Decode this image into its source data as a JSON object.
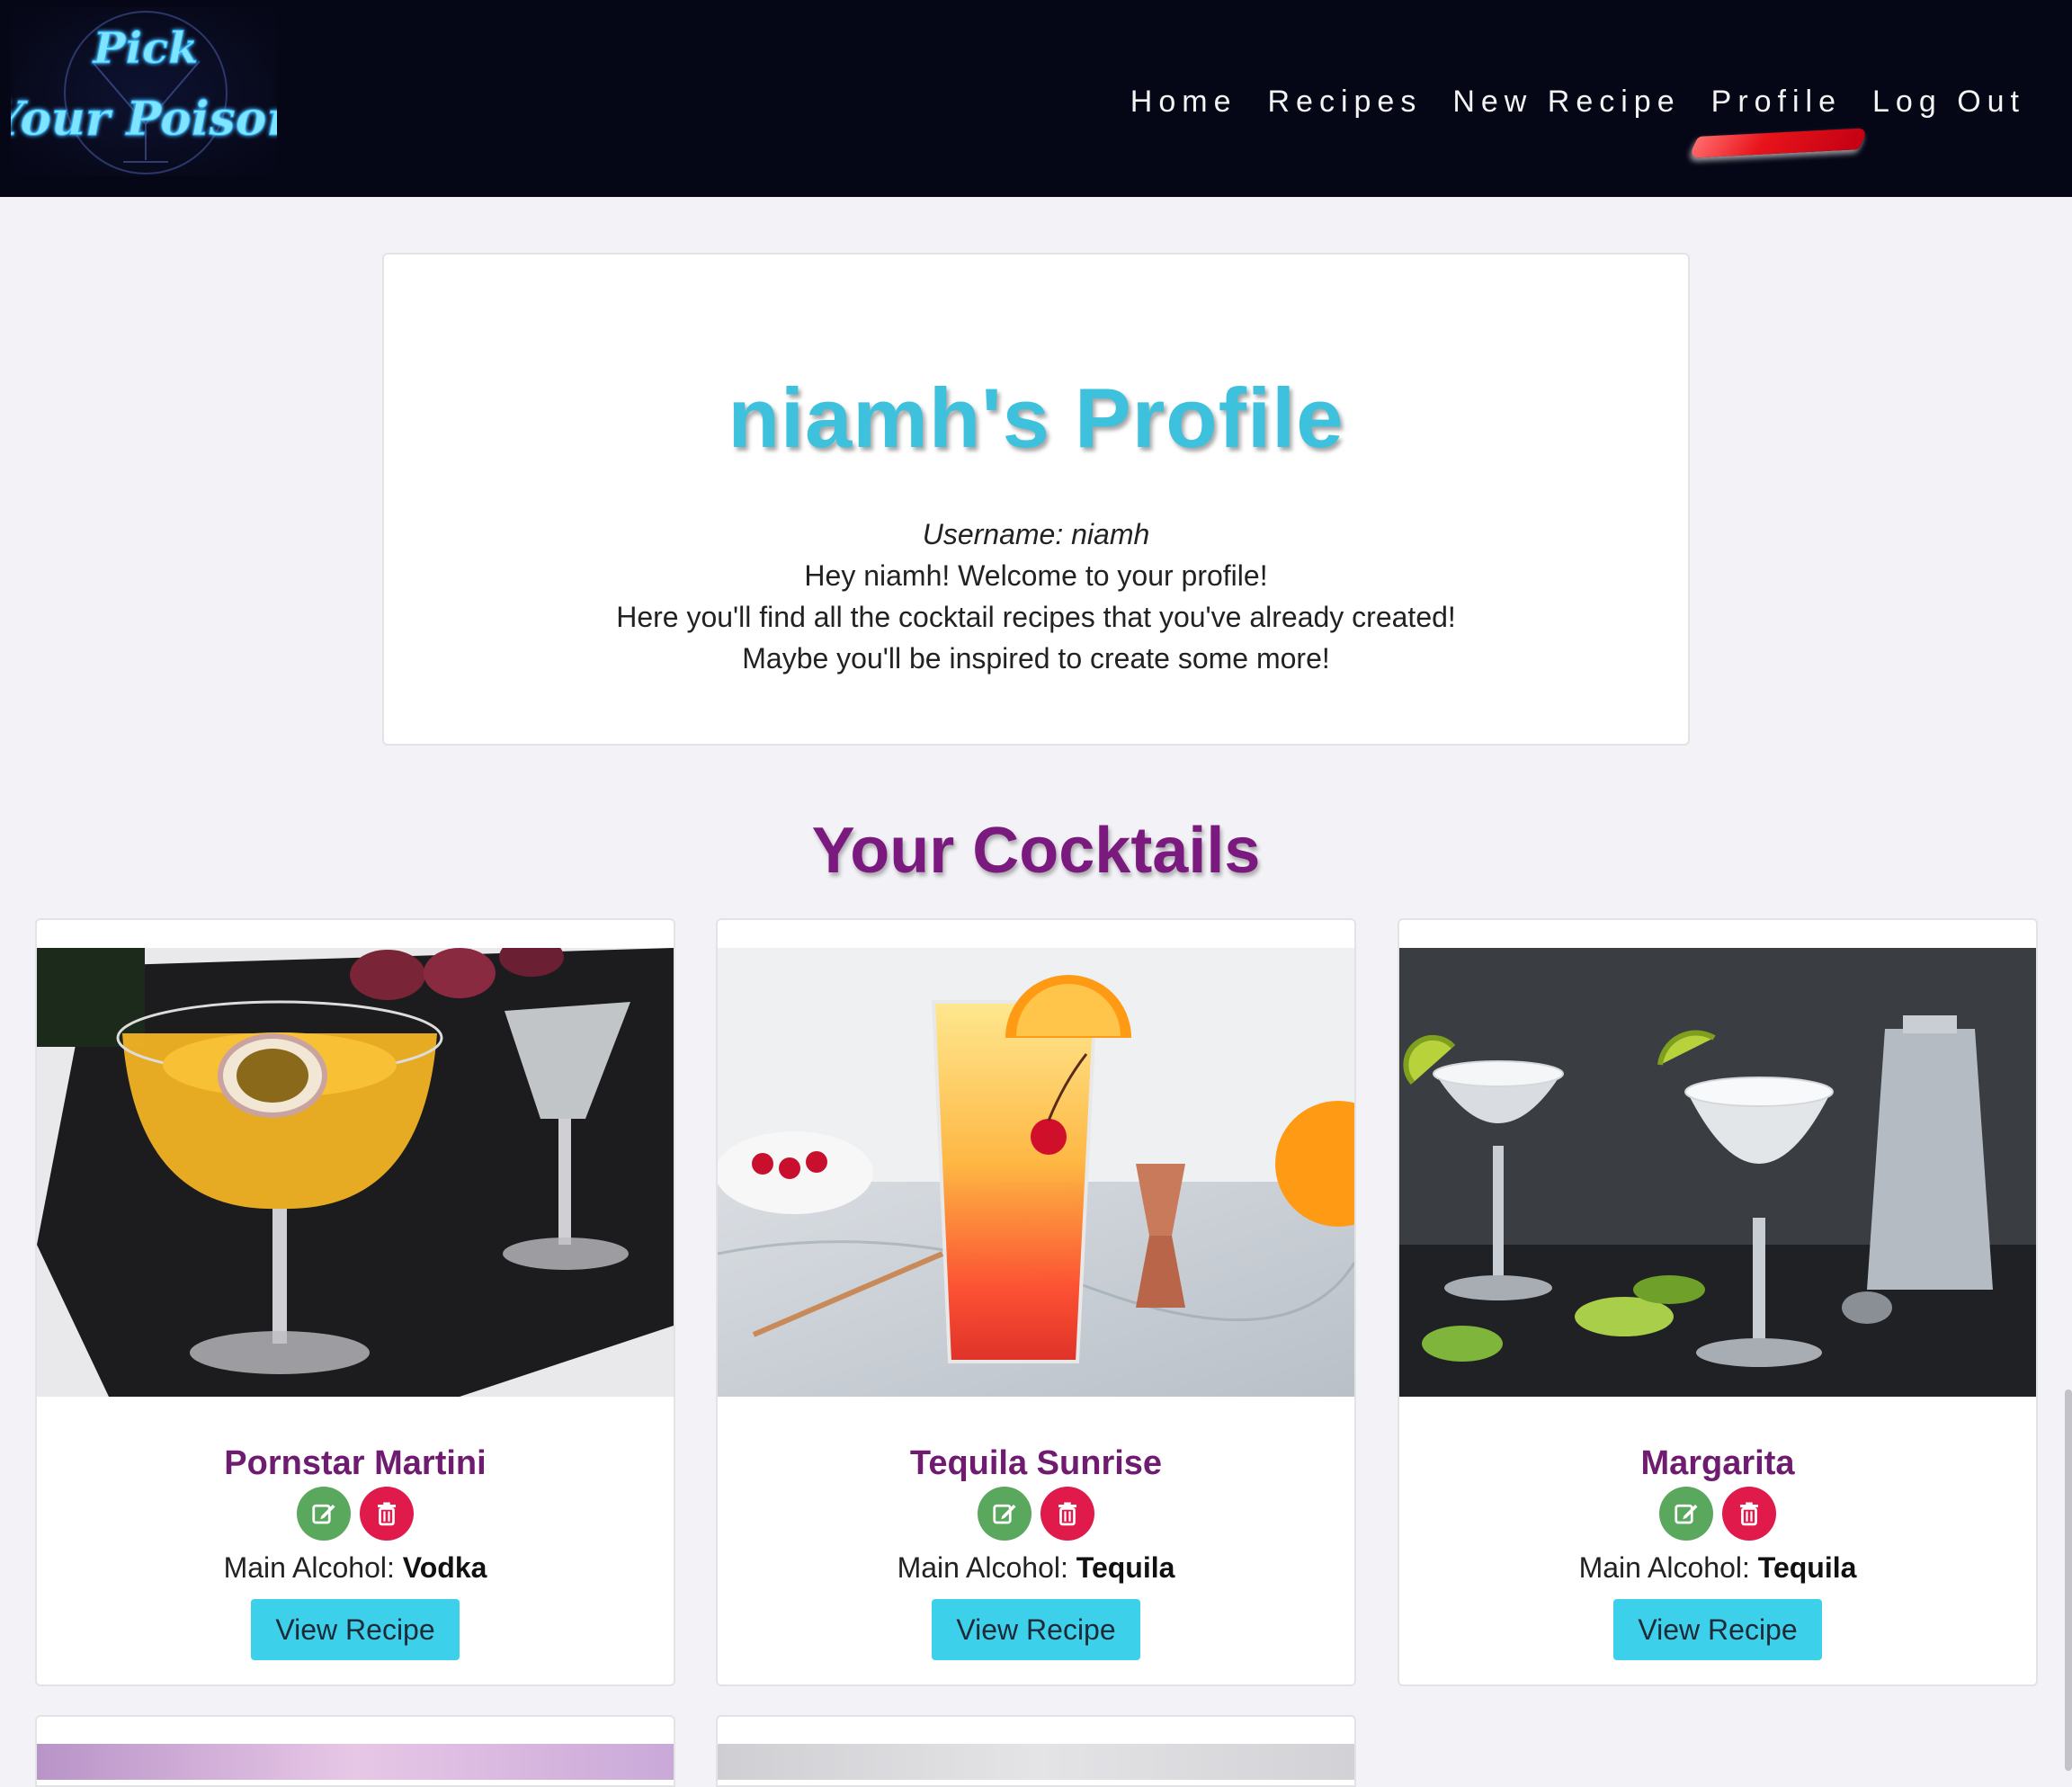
{
  "brand": {
    "logo_line1": "Pick",
    "logo_line2": "Your Poison"
  },
  "nav": {
    "items": [
      {
        "label": "Home"
      },
      {
        "label": "Recipes"
      },
      {
        "label": "New Recipe"
      },
      {
        "label": "Profile",
        "active": true
      },
      {
        "label": "Log Out"
      }
    ]
  },
  "profile": {
    "title": "niamh's Profile",
    "username_line": "Username: niamh",
    "welcome": "Hey niamh! Welcome to your profile!",
    "line2": "Here you'll find all the cocktail recipes that you've already created!",
    "line3": "Maybe you'll be inspired to create some more!"
  },
  "cocktails": {
    "title": "Your Cocktails",
    "main_alcohol_label": "Main Alcohol: ",
    "view_label": "View Recipe",
    "items": [
      {
        "name": "Pornstar Martini",
        "alcohol": "Vodka",
        "image": "pornstar-martini-photo"
      },
      {
        "name": "Tequila Sunrise",
        "alcohol": "Tequila",
        "image": "tequila-sunrise-photo"
      },
      {
        "name": "Margarita",
        "alcohol": "Tequila",
        "image": "margarita-photo"
      }
    ]
  },
  "colors": {
    "navbar_bg": "#050616",
    "profile_title": "#3ec1dc",
    "section_title": "#7b1a7e",
    "card_title": "#6e1b70",
    "edit_button": "#5aa85e",
    "delete_button": "#e01a4a",
    "view_button": "#3dd0ea",
    "active_underline": "#e8141c"
  }
}
